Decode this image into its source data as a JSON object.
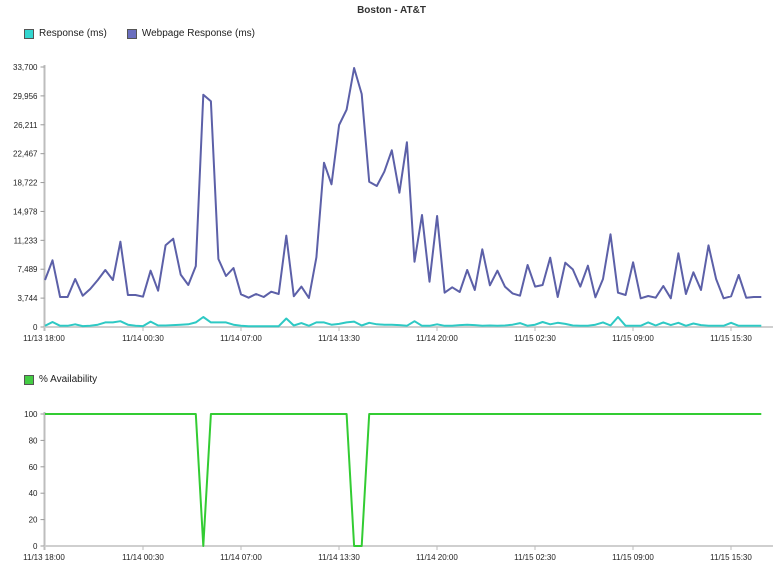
{
  "chart_data": [
    {
      "type": "line",
      "title": "Boston - AT&T",
      "xlabel": "",
      "ylabel": "",
      "ylim": [
        0,
        33700
      ],
      "yticks": [
        "0",
        "3,744",
        "7,489",
        "11,233",
        "14,978",
        "18,722",
        "22,467",
        "26,211",
        "29,956",
        "33,700"
      ],
      "ytick_values": [
        0,
        3744,
        7489,
        11233,
        14978,
        18722,
        22467,
        26211,
        29956,
        33700
      ],
      "xticks": [
        "11/13 18:00",
        "11/14 00:30",
        "11/14 07:00",
        "11/14 13:30",
        "11/14 20:00",
        "11/15 02:30",
        "11/15 09:00",
        "11/15 15:30"
      ],
      "x_start": "11/13 18:00",
      "x_interval_minutes": 30,
      "grid": false,
      "legend_position": "top-left",
      "series": [
        {
          "name": "Response (ms)",
          "color": "#2ec9c4",
          "values": [
            150,
            650,
            150,
            150,
            350,
            120,
            150,
            300,
            600,
            600,
            750,
            300,
            150,
            120,
            700,
            200,
            200,
            250,
            300,
            350,
            600,
            1300,
            600,
            600,
            600,
            300,
            150,
            100,
            100,
            100,
            100,
            100,
            1100,
            200,
            500,
            150,
            600,
            600,
            300,
            400,
            600,
            700,
            200,
            550,
            350,
            300,
            300,
            250,
            150,
            750,
            150,
            150,
            350,
            150,
            150,
            250,
            300,
            250,
            150,
            200,
            150,
            200,
            300,
            500,
            150,
            300,
            650,
            350,
            550,
            400,
            200,
            150,
            150,
            300,
            600,
            200,
            1300,
            150,
            150,
            150,
            600,
            200,
            600,
            250,
            550,
            150,
            450,
            250,
            150,
            150,
            150,
            550,
            150,
            150,
            150,
            150
          ]
        },
        {
          "name": "Webpage Response (ms)",
          "color": "#5c60a8",
          "values": [
            6090,
            8640,
            3890,
            3890,
            6220,
            4060,
            4920,
            6090,
            7390,
            6090,
            11060,
            4150,
            4150,
            3930,
            7300,
            4710,
            10600,
            11440,
            6790,
            5440,
            7900,
            30110,
            29250,
            8810,
            6610,
            7650,
            4240,
            3800,
            4280,
            3890,
            4580,
            4280,
            11850,
            3980,
            5230,
            3760,
            9030,
            21300,
            18490,
            26180,
            28170,
            33570,
            30200,
            18830,
            18270,
            20130,
            22900,
            17410,
            23940,
            8470,
            14520,
            5870,
            14390,
            4450,
            5140,
            4540,
            7390,
            4800,
            10070,
            5400,
            7300,
            5230,
            4360,
            4060,
            8030,
            5230,
            5440,
            8980,
            3890,
            8340,
            7470,
            5230,
            7950,
            3850,
            6220,
            12010,
            4450,
            4150,
            8380,
            3720,
            4020,
            3800,
            5310,
            3720,
            9550,
            4280,
            7090,
            4800,
            10580,
            6220,
            3720,
            3980,
            6740,
            3800,
            3890,
            3890
          ]
        }
      ]
    },
    {
      "type": "line",
      "title": "",
      "xlabel": "",
      "ylabel": "",
      "ylim": [
        0,
        100
      ],
      "yticks": [
        "0",
        "20",
        "40",
        "60",
        "80",
        "100"
      ],
      "ytick_values": [
        0,
        20,
        40,
        60,
        80,
        100
      ],
      "xticks": [
        "11/13 18:00",
        "11/14 00:30",
        "11/14 07:00",
        "11/14 13:30",
        "11/14 20:00",
        "11/15 02:30",
        "11/15 09:00",
        "11/15 15:30"
      ],
      "x_start": "11/13 18:00",
      "x_interval_minutes": 30,
      "grid": false,
      "legend_position": "top-left",
      "series": [
        {
          "name": "% Availability",
          "color": "#33cc33",
          "values": [
            100,
            100,
            100,
            100,
            100,
            100,
            100,
            100,
            100,
            100,
            100,
            100,
            100,
            100,
            100,
            100,
            100,
            100,
            100,
            100,
            100,
            0,
            100,
            100,
            100,
            100,
            100,
            100,
            100,
            100,
            100,
            100,
            100,
            100,
            100,
            100,
            100,
            100,
            100,
            100,
            100,
            0,
            0,
            100,
            100,
            100,
            100,
            100,
            100,
            100,
            100,
            100,
            100,
            100,
            100,
            100,
            100,
            100,
            100,
            100,
            100,
            100,
            100,
            100,
            100,
            100,
            100,
            100,
            100,
            100,
            100,
            100,
            100,
            100,
            100,
            100,
            100,
            100,
            100,
            100,
            100,
            100,
            100,
            100,
            100,
            100,
            100,
            100,
            100,
            100,
            100,
            100,
            100,
            100,
            100,
            100
          ]
        }
      ]
    }
  ],
  "legend_colors": {
    "response": "#33d6d0",
    "webpage_response": "#6b6fbf",
    "availability": "#44cc44"
  }
}
